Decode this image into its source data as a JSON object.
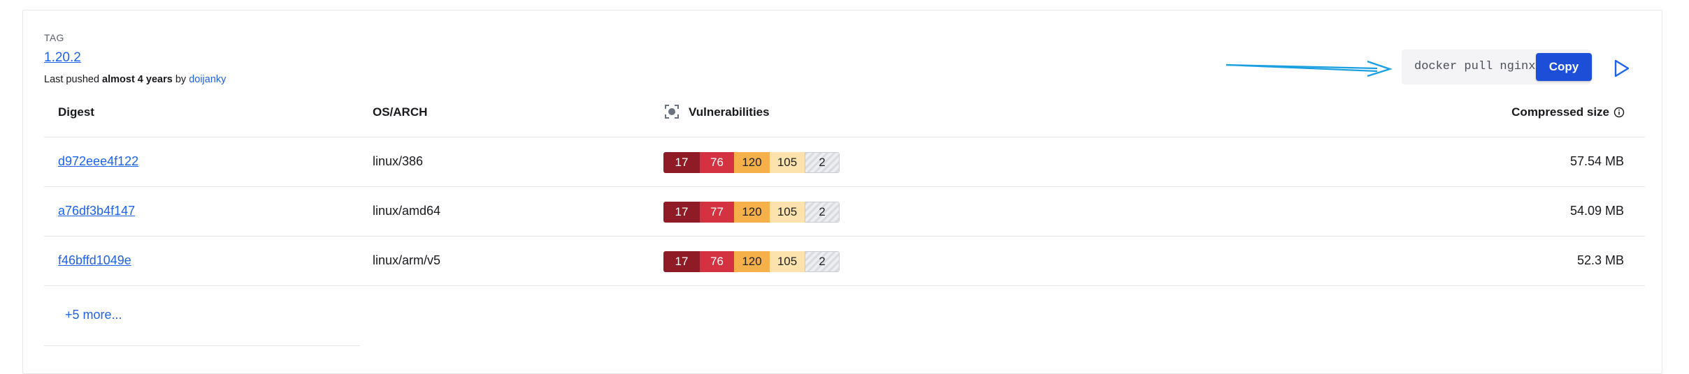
{
  "tag": {
    "label": "TAG",
    "name": "1.20.2",
    "pushed_prefix": "Last pushed ",
    "pushed_when": "almost 4 years",
    "pushed_by_text": " by ",
    "pushed_user": "doijanky"
  },
  "pull": {
    "command": "docker pull nginx",
    "copy_label": "Copy"
  },
  "table": {
    "headers": {
      "digest": "Digest",
      "os_arch": "OS/ARCH",
      "vulnerabilities": "Vulnerabilities",
      "compressed_size": "Compressed size"
    },
    "rows": [
      {
        "digest": "d972eee4f122",
        "os_arch": "linux/386",
        "vulns": {
          "critical": "17",
          "high": "76",
          "medium": "120",
          "low": "105",
          "unspecified": "2"
        },
        "size": "57.54 MB"
      },
      {
        "digest": "a76df3b4f147",
        "os_arch": "linux/amd64",
        "vulns": {
          "critical": "17",
          "high": "77",
          "medium": "120",
          "low": "105",
          "unspecified": "2"
        },
        "size": "54.09 MB"
      },
      {
        "digest": "f46bffd1049e",
        "os_arch": "linux/arm/v5",
        "vulns": {
          "critical": "17",
          "high": "76",
          "medium": "120",
          "low": "105",
          "unspecified": "2"
        },
        "size": "52.3 MB"
      }
    ],
    "more_label": "+5 more..."
  },
  "colors": {
    "link": "#1d63ed",
    "copy_button": "#1c4ed8",
    "critical": "#8e1b26",
    "high": "#d43241",
    "medium": "#f5b04a",
    "low": "#fce3ad",
    "annotation_arrow": "#1a9fe0"
  },
  "icons": {
    "vulnerabilities": "scan-icon",
    "size_info": "info-icon",
    "run": "play-icon",
    "annotation": "arrow-right-icon"
  }
}
